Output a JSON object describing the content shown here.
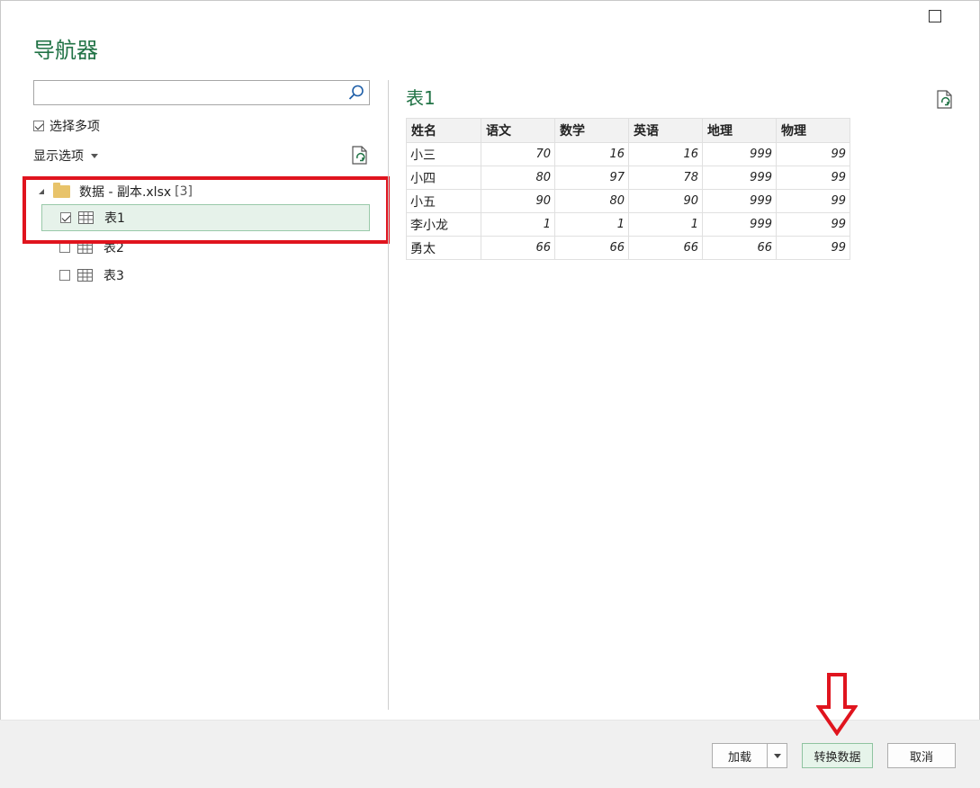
{
  "window": {
    "title": "导航器"
  },
  "search": {
    "value": "",
    "placeholder": ""
  },
  "options": {
    "select_multiple_label": "选择多项",
    "select_multiple_checked": true,
    "display_options_label": "显示选项"
  },
  "tree": {
    "root": {
      "label": "数据 - 副本.xlsx",
      "count": "[3]"
    },
    "items": [
      {
        "label": "表1",
        "checked": true,
        "selected": true
      },
      {
        "label": "表2",
        "checked": false,
        "selected": false
      },
      {
        "label": "表3",
        "checked": false,
        "selected": false
      }
    ]
  },
  "preview": {
    "title": "表1",
    "columns": [
      "姓名",
      "语文",
      "数学",
      "英语",
      "地理",
      "物理"
    ],
    "rows": [
      [
        "小三",
        "70",
        "16",
        "16",
        "999",
        "99"
      ],
      [
        "小四",
        "80",
        "97",
        "78",
        "999",
        "99"
      ],
      [
        "小五",
        "90",
        "80",
        "90",
        "999",
        "99"
      ],
      [
        "李小龙",
        "1",
        "1",
        "1",
        "999",
        "99"
      ],
      [
        "勇太",
        "66",
        "66",
        "66",
        "66",
        "99"
      ]
    ]
  },
  "footer": {
    "load_label": "加载",
    "transform_label": "转换数据",
    "cancel_label": "取消"
  },
  "colors": {
    "accent": "#217346",
    "highlight": "#e0141e",
    "selected_bg": "#e6f2ea"
  },
  "icons": {
    "maximize": "maximize-icon",
    "search": "search-icon",
    "refresh": "refresh-icon",
    "folder": "folder-icon",
    "table": "table-icon"
  }
}
